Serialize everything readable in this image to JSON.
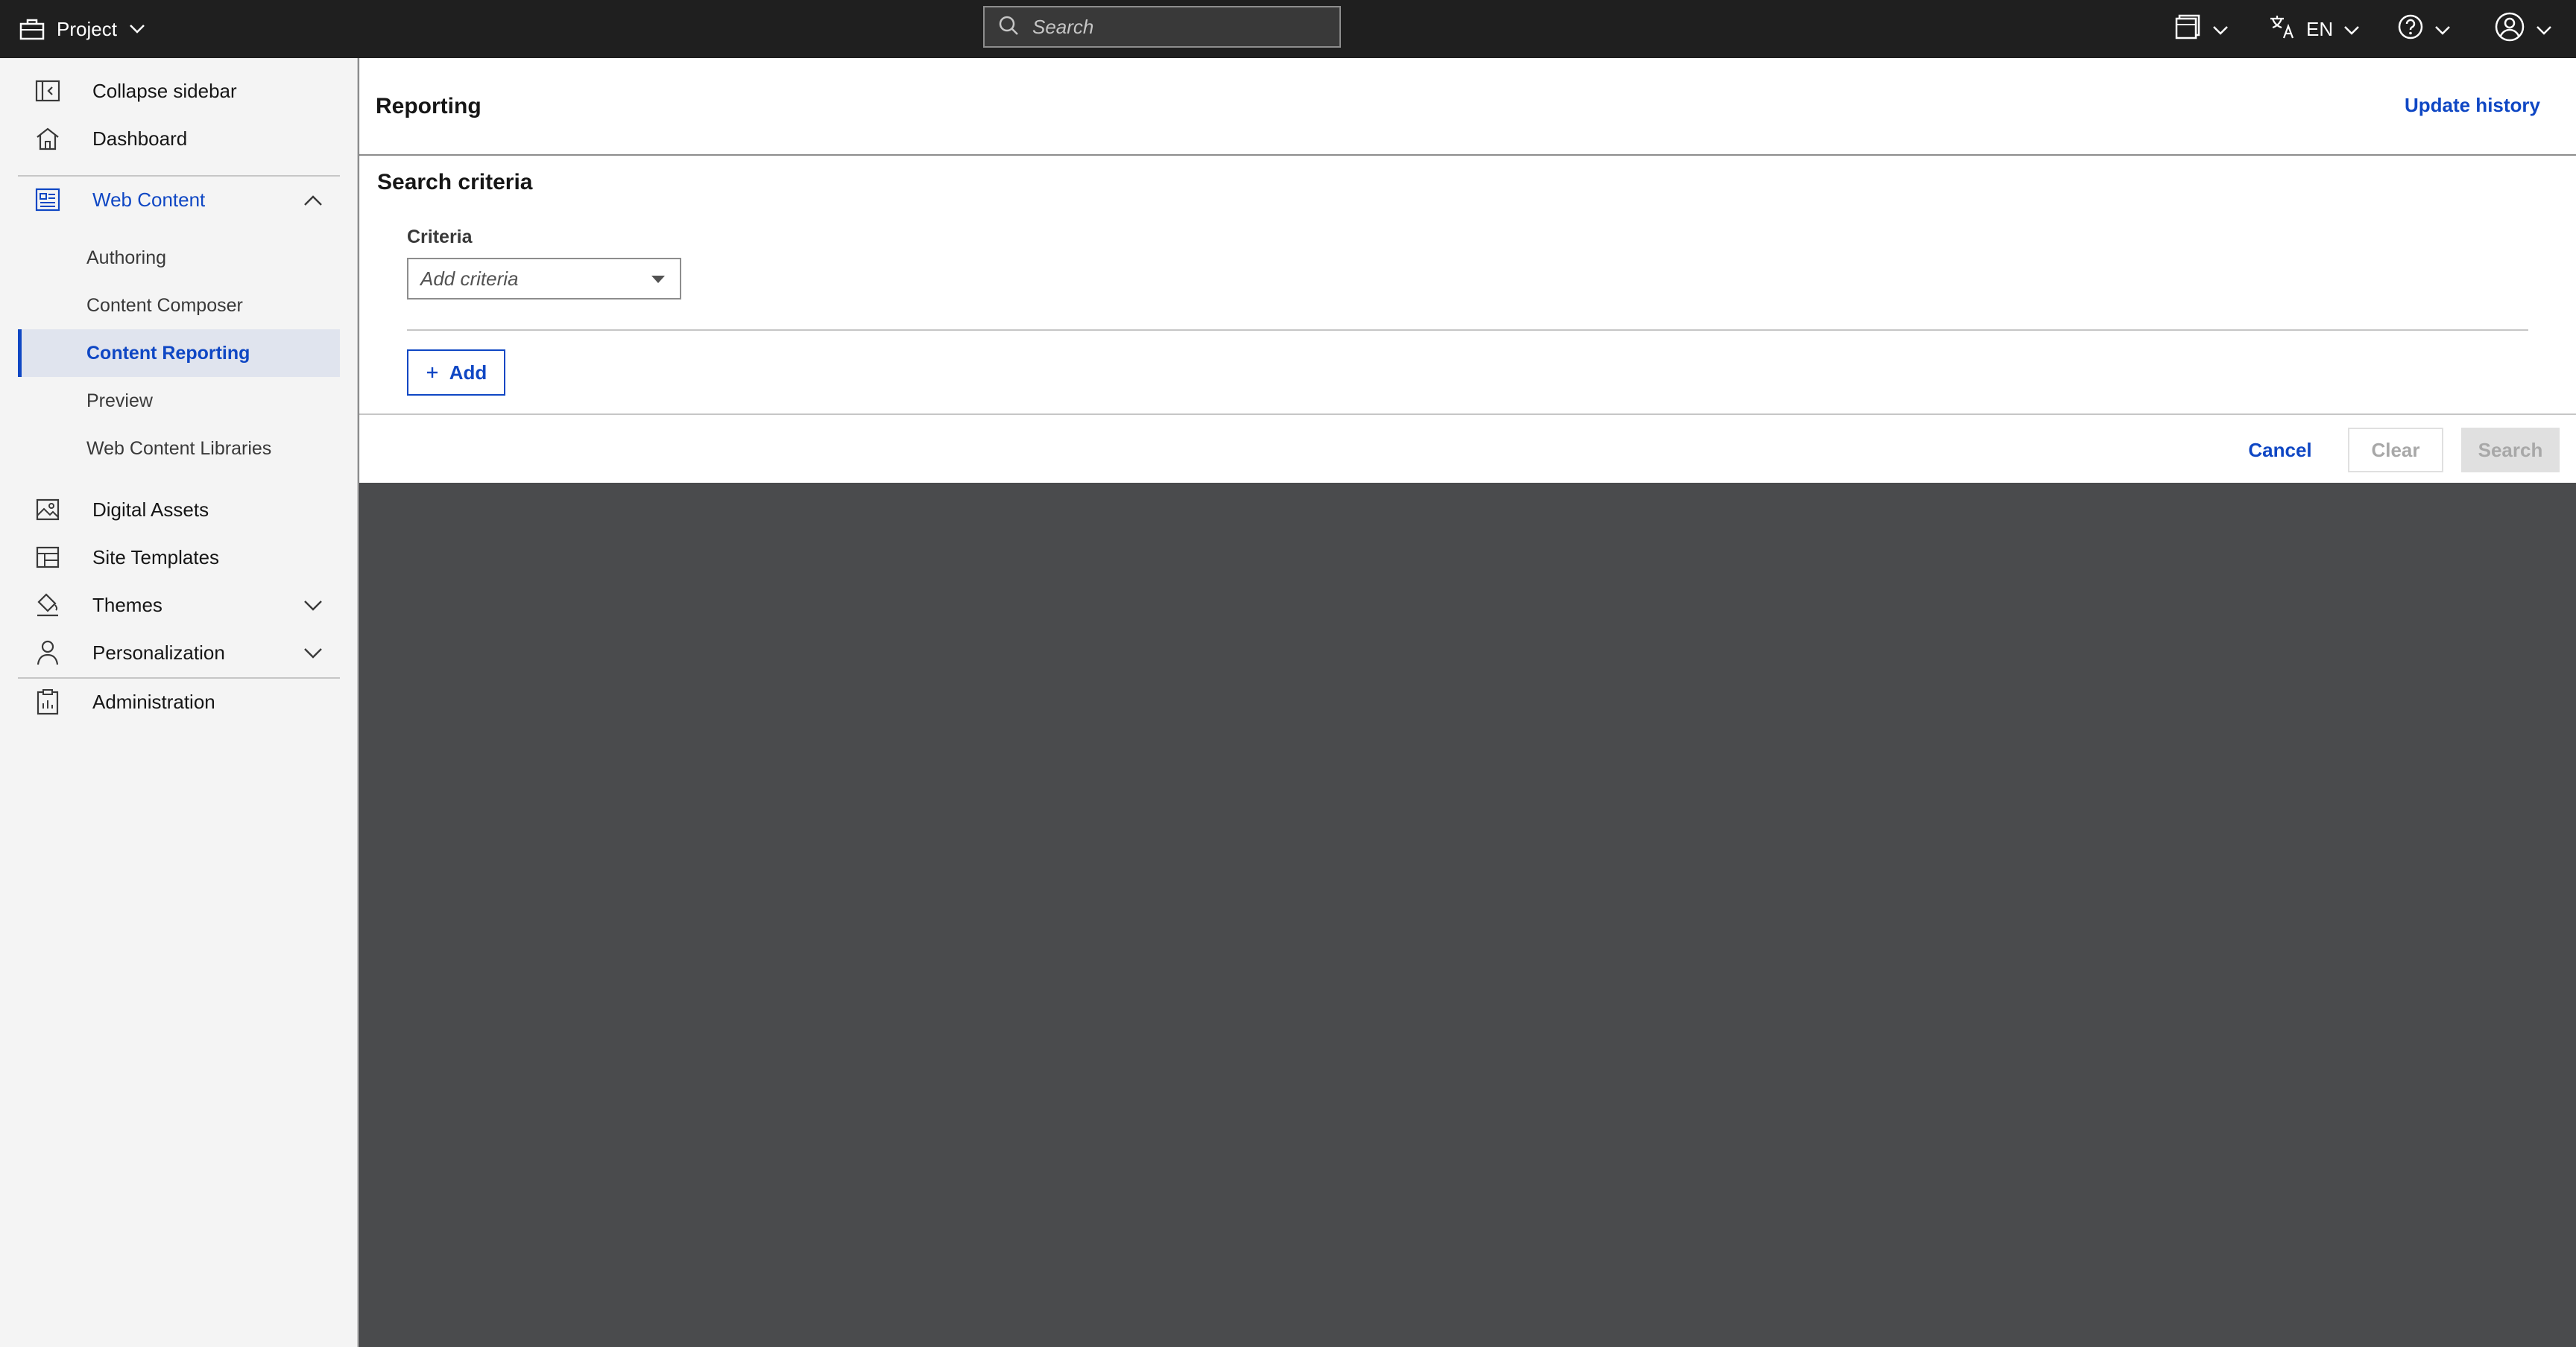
{
  "topbar": {
    "project_label": "Project",
    "search_placeholder": "Search",
    "language_label": "EN"
  },
  "sidebar": {
    "collapse_label": "Collapse sidebar",
    "dashboard_label": "Dashboard",
    "web_content_label": "Web Content",
    "sub_items": [
      "Authoring",
      "Content Composer",
      "Content Reporting",
      "Preview",
      "Web Content Libraries"
    ],
    "active_sub_item": "Content Reporting",
    "digital_assets_label": "Digital Assets",
    "site_templates_label": "Site Templates",
    "themes_label": "Themes",
    "personalization_label": "Personalization",
    "administration_label": "Administration"
  },
  "main": {
    "title": "Reporting",
    "update_history_label": "Update history",
    "section_title": "Search criteria",
    "criteria_label": "Criteria",
    "criteria_placeholder": "Add criteria",
    "add_label": "Add",
    "cancel_label": "Cancel",
    "clear_label": "Clear",
    "search_label": "Search"
  },
  "colors": {
    "accent": "#0f47c4",
    "topbar": "#1f1f1f",
    "overlay": "#4a4b4d"
  }
}
